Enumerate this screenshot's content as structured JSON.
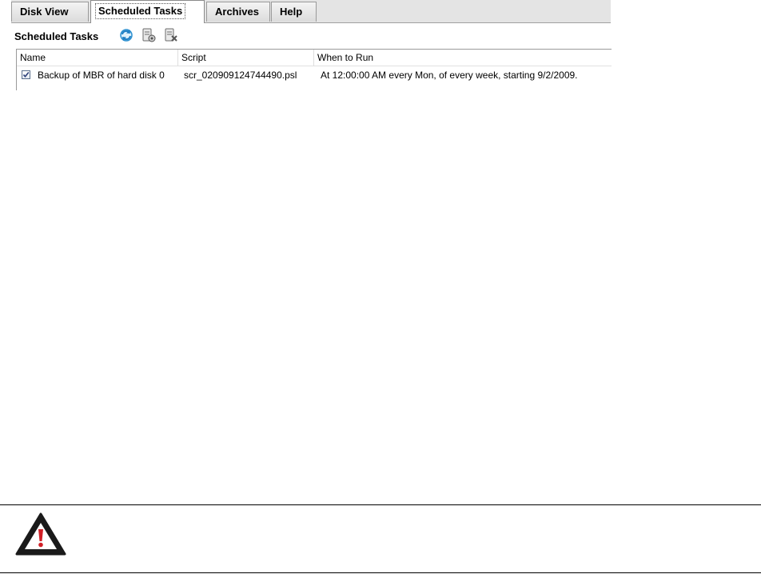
{
  "tabs": [
    {
      "label": "Disk View",
      "active": false
    },
    {
      "label": "Scheduled Tasks",
      "active": true
    },
    {
      "label": "Archives",
      "active": false
    },
    {
      "label": "Help",
      "active": false
    }
  ],
  "toolbar": {
    "title": "Scheduled Tasks",
    "buttons": [
      {
        "icon": "refresh-icon"
      },
      {
        "icon": "task-properties-icon"
      },
      {
        "icon": "delete-task-icon"
      }
    ]
  },
  "table": {
    "columns": [
      "Name",
      "Script",
      "When to Run"
    ],
    "rows": [
      {
        "checked": true,
        "name": "Backup of MBR of hard disk 0",
        "script": "scr_020909124744490.psl",
        "when": "At 12:00:00 AM every Mon,  of every week, starting 9/2/2009."
      }
    ]
  },
  "caution": {
    "icon": "warning-icon",
    "colors": {
      "triangle": "#1a1a1a",
      "mark": "#d11f26"
    }
  }
}
